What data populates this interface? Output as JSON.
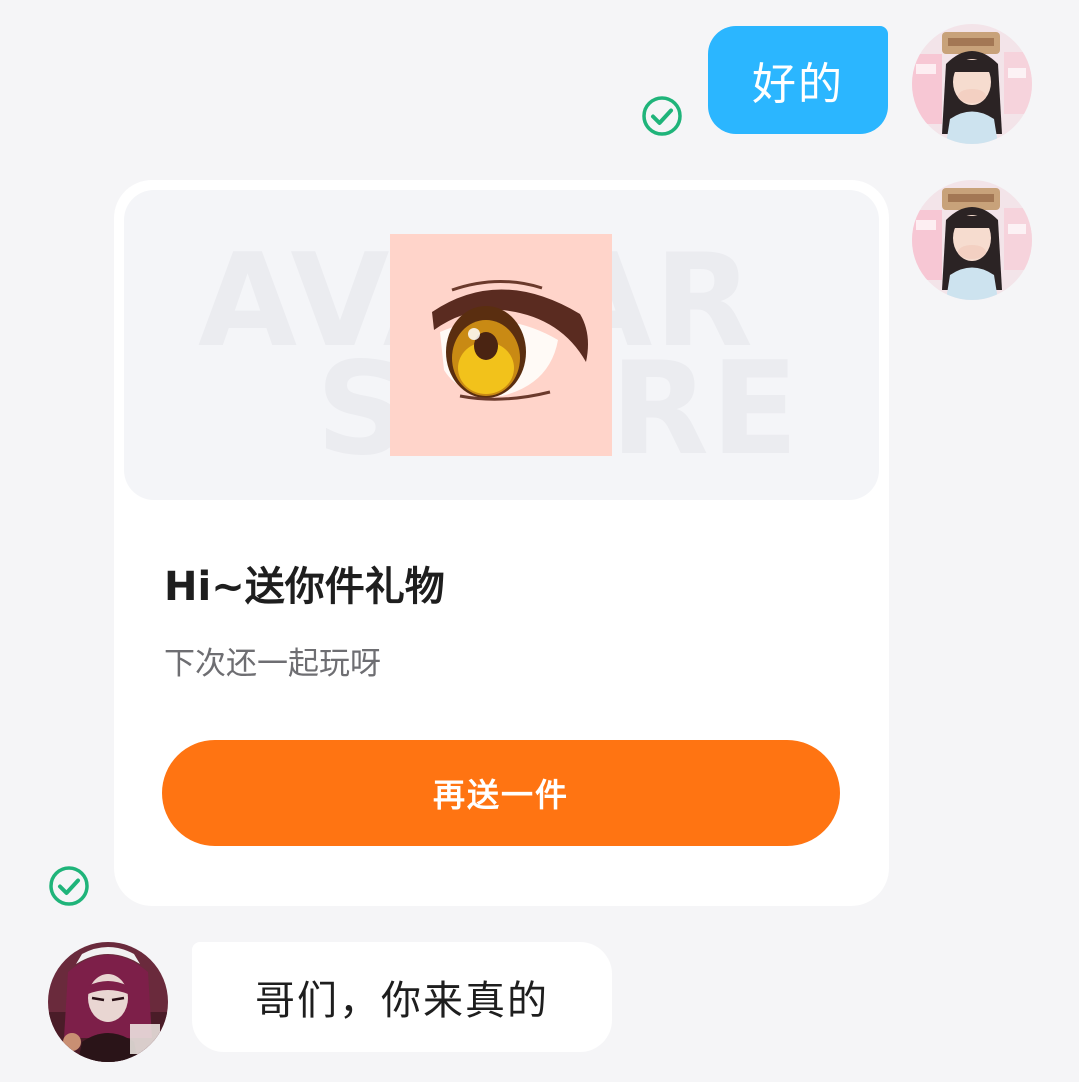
{
  "messages": {
    "outgoing_text": "好的",
    "gift_card": {
      "watermark_line1": "AVATAR",
      "watermark_line2": "STORE",
      "title": "Hi~送你件礼物",
      "subtitle": "下次还一起玩呀",
      "button_label": "再送一件",
      "item_icon": "anime-eye-icon"
    },
    "incoming_text": "哥们，你来真的"
  },
  "icons": {
    "read_receipt": "check-circle-icon",
    "self_avatar": "avatar",
    "peer_avatar": "avatar"
  },
  "colors": {
    "page_background": "#f5f5f7",
    "outgoing_bubble": "#2bb6ff",
    "gift_button": "#ff7412",
    "read_check": "#1fb47a"
  }
}
